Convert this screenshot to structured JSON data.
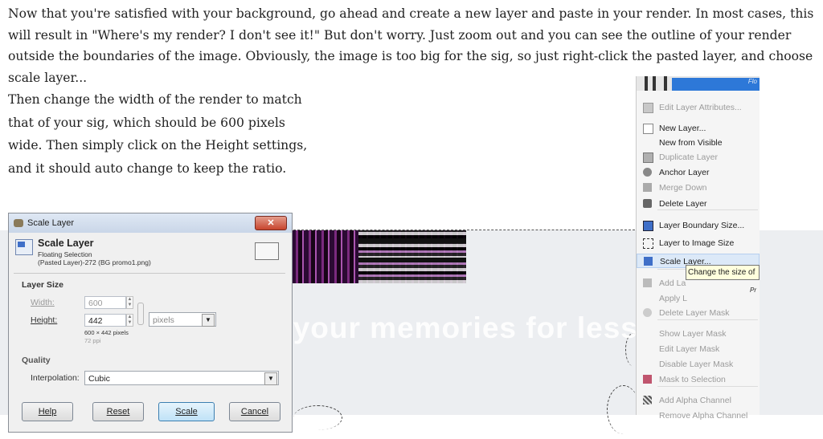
{
  "article": {
    "paragraph_1": "Now that you're satisfied with your background, go ahead and create a new layer and paste in your render. In most cases, this will result in \"Where's my render? I don't see it!\" But don't worry. Just zoom out and you can see the outline of your render outside the boundaries of the image. Obviously, the image is too big for the sig, so just right-click the pasted layer, and choose scale layer...",
    "paragraph_2": "Then change the width of the render to match that of your sig, which should be 600 pixels wide. Then simply click on the Height settings, and it should auto change to keep the ratio."
  },
  "watermark": "Protect more of your memories for less!",
  "dialog": {
    "window_title": "Scale Layer",
    "header_title": "Scale Layer",
    "header_line_1": "Floating Selection",
    "header_line_2": "(Pasted Layer)-272 (BG promo1.png)",
    "section_layer_size": "Layer Size",
    "width_label": "Width:",
    "width_value": "600",
    "height_label": "Height:",
    "height_value": "442",
    "size_info": "600 × 442 pixels",
    "ppi_info": "72 ppi",
    "unit": "pixels",
    "section_quality": "Quality",
    "interpolation_label": "Interpolation:",
    "interpolation_value": "Cubic",
    "buttons": {
      "help": "Help",
      "reset": "Reset",
      "scale": "Scale",
      "cancel": "Cancel"
    }
  },
  "menu": {
    "header_text": "Flo",
    "items": [
      {
        "label": "Edit Layer Attributes...",
        "enabled": false,
        "icon": "edit-attributes-icon"
      },
      {
        "label": "New Layer...",
        "enabled": true,
        "icon": "new-layer-icon"
      },
      {
        "label": "New from Visible",
        "enabled": true,
        "icon": ""
      },
      {
        "label": "Duplicate Layer",
        "enabled": false,
        "icon": "duplicate-layer-icon"
      },
      {
        "label": "Anchor Layer",
        "enabled": true,
        "icon": "anchor-icon"
      },
      {
        "label": "Merge Down",
        "enabled": false,
        "icon": "merge-down-icon"
      },
      {
        "label": "Delete Layer",
        "enabled": true,
        "icon": "delete-icon"
      },
      {
        "label": "Layer Boundary Size...",
        "enabled": true,
        "icon": "boundary-size-icon"
      },
      {
        "label": "Layer to Image Size",
        "enabled": true,
        "icon": "layer-to-image-icon"
      },
      {
        "label": "Scale Layer...",
        "enabled": true,
        "icon": "scale-layer-icon"
      },
      {
        "label": "Add La",
        "enabled": false,
        "icon": "add-mask-icon"
      },
      {
        "label": "Apply L",
        "enabled": false,
        "icon": ""
      },
      {
        "label": "Delete Layer Mask",
        "enabled": false,
        "icon": "delete-mask-icon"
      },
      {
        "label": "Show Layer Mask",
        "enabled": false,
        "icon": ""
      },
      {
        "label": "Edit Layer Mask",
        "enabled": false,
        "icon": ""
      },
      {
        "label": "Disable Layer Mask",
        "enabled": false,
        "icon": ""
      },
      {
        "label": "Mask to Selection",
        "enabled": false,
        "icon": "mask-selection-icon"
      },
      {
        "label": "Add Alpha Channel",
        "enabled": false,
        "icon": "alpha-icon"
      },
      {
        "label": "Remove Alpha Channel",
        "enabled": false,
        "icon": ""
      }
    ]
  },
  "tooltip": {
    "text": "Change the size of",
    "fragment": "Pr"
  },
  "colors": {
    "menu_highlight": "#dce9f8",
    "layer_thumb": "#2d78d8",
    "tooltip_bg": "#ffffdd"
  }
}
